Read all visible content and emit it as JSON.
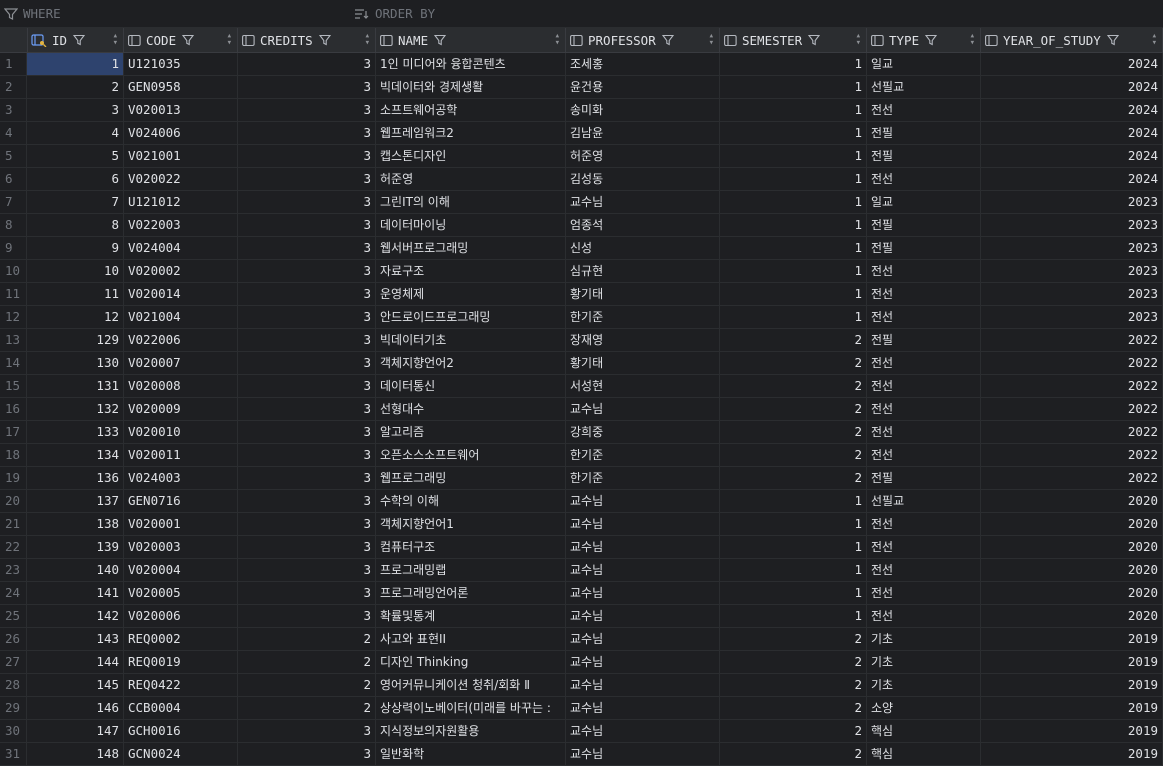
{
  "filter": {
    "where_label": "WHERE",
    "order_label": "ORDER BY"
  },
  "columns": [
    {
      "label": "ID",
      "icon": "primary-key-column-icon"
    },
    {
      "label": "CODE",
      "icon": "column-icon"
    },
    {
      "label": "CREDITS",
      "icon": "column-icon"
    },
    {
      "label": "NAME",
      "icon": "column-icon"
    },
    {
      "label": "PROFESSOR",
      "icon": "column-icon"
    },
    {
      "label": "SEMESTER",
      "icon": "column-icon"
    },
    {
      "label": "TYPE",
      "icon": "column-icon"
    },
    {
      "label": "YEAR_OF_STUDY",
      "icon": "column-icon"
    }
  ],
  "rows": [
    {
      "n": "1",
      "id": "1",
      "code": "U121035",
      "credits": "3",
      "name": " 1인 미디어와 융합콘텐츠",
      "prof": "조세홍",
      "sem": "1",
      "type": "일교",
      "year": "2024"
    },
    {
      "n": "2",
      "id": "2",
      "code": "GEN0958",
      "credits": "3",
      "name": " 빅데이터와 경제생활",
      "prof": "윤건용",
      "sem": "1",
      "type": "선필교",
      "year": "2024"
    },
    {
      "n": "3",
      "id": "3",
      "code": "V020013",
      "credits": "3",
      "name": "소프트웨어공학",
      "prof": "송미화",
      "sem": "1",
      "type": "전선",
      "year": "2024"
    },
    {
      "n": "4",
      "id": "4",
      "code": "V024006",
      "credits": "3",
      "name": "웹프레임워크2",
      "prof": "김남윤",
      "sem": "1",
      "type": "전필",
      "year": "2024"
    },
    {
      "n": "5",
      "id": "5",
      "code": "V021001",
      "credits": "3",
      "name": "캡스톤디자인",
      "prof": "허준영",
      "sem": "1",
      "type": "전필",
      "year": "2024"
    },
    {
      "n": "6",
      "id": "6",
      "code": "V020022",
      "credits": "3",
      "name": "허준영",
      "prof": "김성동",
      "sem": "1",
      "type": "전선",
      "year": "2024"
    },
    {
      "n": "7",
      "id": "7",
      "code": "U121012",
      "credits": "3",
      "name": "그린IT의 이해",
      "prof": "교수님",
      "sem": "1",
      "type": "일교",
      "year": "2023"
    },
    {
      "n": "8",
      "id": "8",
      "code": "V022003",
      "credits": "3",
      "name": "데이터마이닝",
      "prof": "엄종석",
      "sem": "1",
      "type": "전필",
      "year": "2023"
    },
    {
      "n": "9",
      "id": "9",
      "code": "V024004",
      "credits": "3",
      "name": "웹서버프로그래밍",
      "prof": "신성",
      "sem": "1",
      "type": "전필",
      "year": "2023"
    },
    {
      "n": "10",
      "id": "10",
      "code": "V020002",
      "credits": "3",
      "name": "자료구조",
      "prof": "심규현",
      "sem": "1",
      "type": "전선",
      "year": "2023"
    },
    {
      "n": "11",
      "id": "11",
      "code": "V020014",
      "credits": "3",
      "name": "운영체제",
      "prof": "황기태",
      "sem": "1",
      "type": "전선",
      "year": "2023"
    },
    {
      "n": "12",
      "id": "12",
      "code": "V021004",
      "credits": "3",
      "name": "안드로이드프로그래밍",
      "prof": "한기준",
      "sem": "1",
      "type": "전선",
      "year": "2023"
    },
    {
      "n": "13",
      "id": "129",
      "code": "V022006",
      "credits": "3",
      "name": "빅데이터기초",
      "prof": "장재영",
      "sem": "2",
      "type": "전필",
      "year": "2022"
    },
    {
      "n": "14",
      "id": "130",
      "code": "V020007",
      "credits": "3",
      "name": "객체지향언어2",
      "prof": "황기태",
      "sem": "2",
      "type": "전선",
      "year": "2022"
    },
    {
      "n": "15",
      "id": "131",
      "code": "V020008",
      "credits": "3",
      "name": "데이터통신",
      "prof": "서성현",
      "sem": "2",
      "type": "전선",
      "year": "2022"
    },
    {
      "n": "16",
      "id": "132",
      "code": "V020009",
      "credits": "3",
      "name": "선형대수",
      "prof": "교수님",
      "sem": "2",
      "type": "전선",
      "year": "2022"
    },
    {
      "n": "17",
      "id": "133",
      "code": "V020010",
      "credits": "3",
      "name": "알고리즘",
      "prof": "강희중",
      "sem": "2",
      "type": "전선",
      "year": "2022"
    },
    {
      "n": "18",
      "id": "134",
      "code": "V020011",
      "credits": "3",
      "name": "오픈소스소프트웨어",
      "prof": "한기준",
      "sem": "2",
      "type": "전선",
      "year": "2022"
    },
    {
      "n": "19",
      "id": "136",
      "code": "V024003",
      "credits": "3",
      "name": "웹프로그래밍",
      "prof": "한기준",
      "sem": "2",
      "type": "전필",
      "year": "2022"
    },
    {
      "n": "20",
      "id": "137",
      "code": "GEN0716",
      "credits": "3",
      "name": "수학의 이해",
      "prof": "교수님",
      "sem": "1",
      "type": "선필교",
      "year": "2020"
    },
    {
      "n": "21",
      "id": "138",
      "code": "V020001",
      "credits": "3",
      "name": "객체지향언어1",
      "prof": "교수님",
      "sem": "1",
      "type": "전선",
      "year": "2020"
    },
    {
      "n": "22",
      "id": "139",
      "code": "V020003",
      "credits": "3",
      "name": "컴퓨터구조",
      "prof": "교수님",
      "sem": "1",
      "type": "전선",
      "year": "2020"
    },
    {
      "n": "23",
      "id": "140",
      "code": "V020004",
      "credits": "3",
      "name": "프로그래밍랩",
      "prof": "교수님",
      "sem": "1",
      "type": "전선",
      "year": "2020"
    },
    {
      "n": "24",
      "id": "141",
      "code": "V020005",
      "credits": "3",
      "name": "프로그래밍언어론",
      "prof": "교수님",
      "sem": "1",
      "type": "전선",
      "year": "2020"
    },
    {
      "n": "25",
      "id": "142",
      "code": "V020006",
      "credits": "3",
      "name": "확률및통계",
      "prof": "교수님",
      "sem": "1",
      "type": "전선",
      "year": "2020"
    },
    {
      "n": "26",
      "id": "143",
      "code": "REQ0002",
      "credits": "2",
      "name": "사고와 표현II",
      "prof": "교수님",
      "sem": "2",
      "type": "기초",
      "year": "2019"
    },
    {
      "n": "27",
      "id": "144",
      "code": "REQ0019",
      "credits": "2",
      "name": "디자인 Thinking",
      "prof": "교수님",
      "sem": "2",
      "type": "기초",
      "year": "2019"
    },
    {
      "n": "28",
      "id": "145",
      "code": "REQ0422",
      "credits": "2",
      "name": "영어커뮤니케이션 청취/회화 Ⅱ",
      "prof": "교수님",
      "sem": "2",
      "type": "기초",
      "year": "2019"
    },
    {
      "n": "29",
      "id": "146",
      "code": "CCB0004",
      "credits": "2",
      "name": "상상력이노베이터(미래를 바꾸는 :",
      "prof": "교수님",
      "sem": "2",
      "type": "소양",
      "year": "2019"
    },
    {
      "n": "30",
      "id": "147",
      "code": "GCH0016",
      "credits": "3",
      "name": "지식정보의자원활용",
      "prof": "교수님",
      "sem": "2",
      "type": "핵심",
      "year": "2019"
    },
    {
      "n": "31",
      "id": "148",
      "code": "GCN0024",
      "credits": "3",
      "name": "일반화학",
      "prof": "교수님",
      "sem": "2",
      "type": "핵심",
      "year": "2019"
    }
  ]
}
